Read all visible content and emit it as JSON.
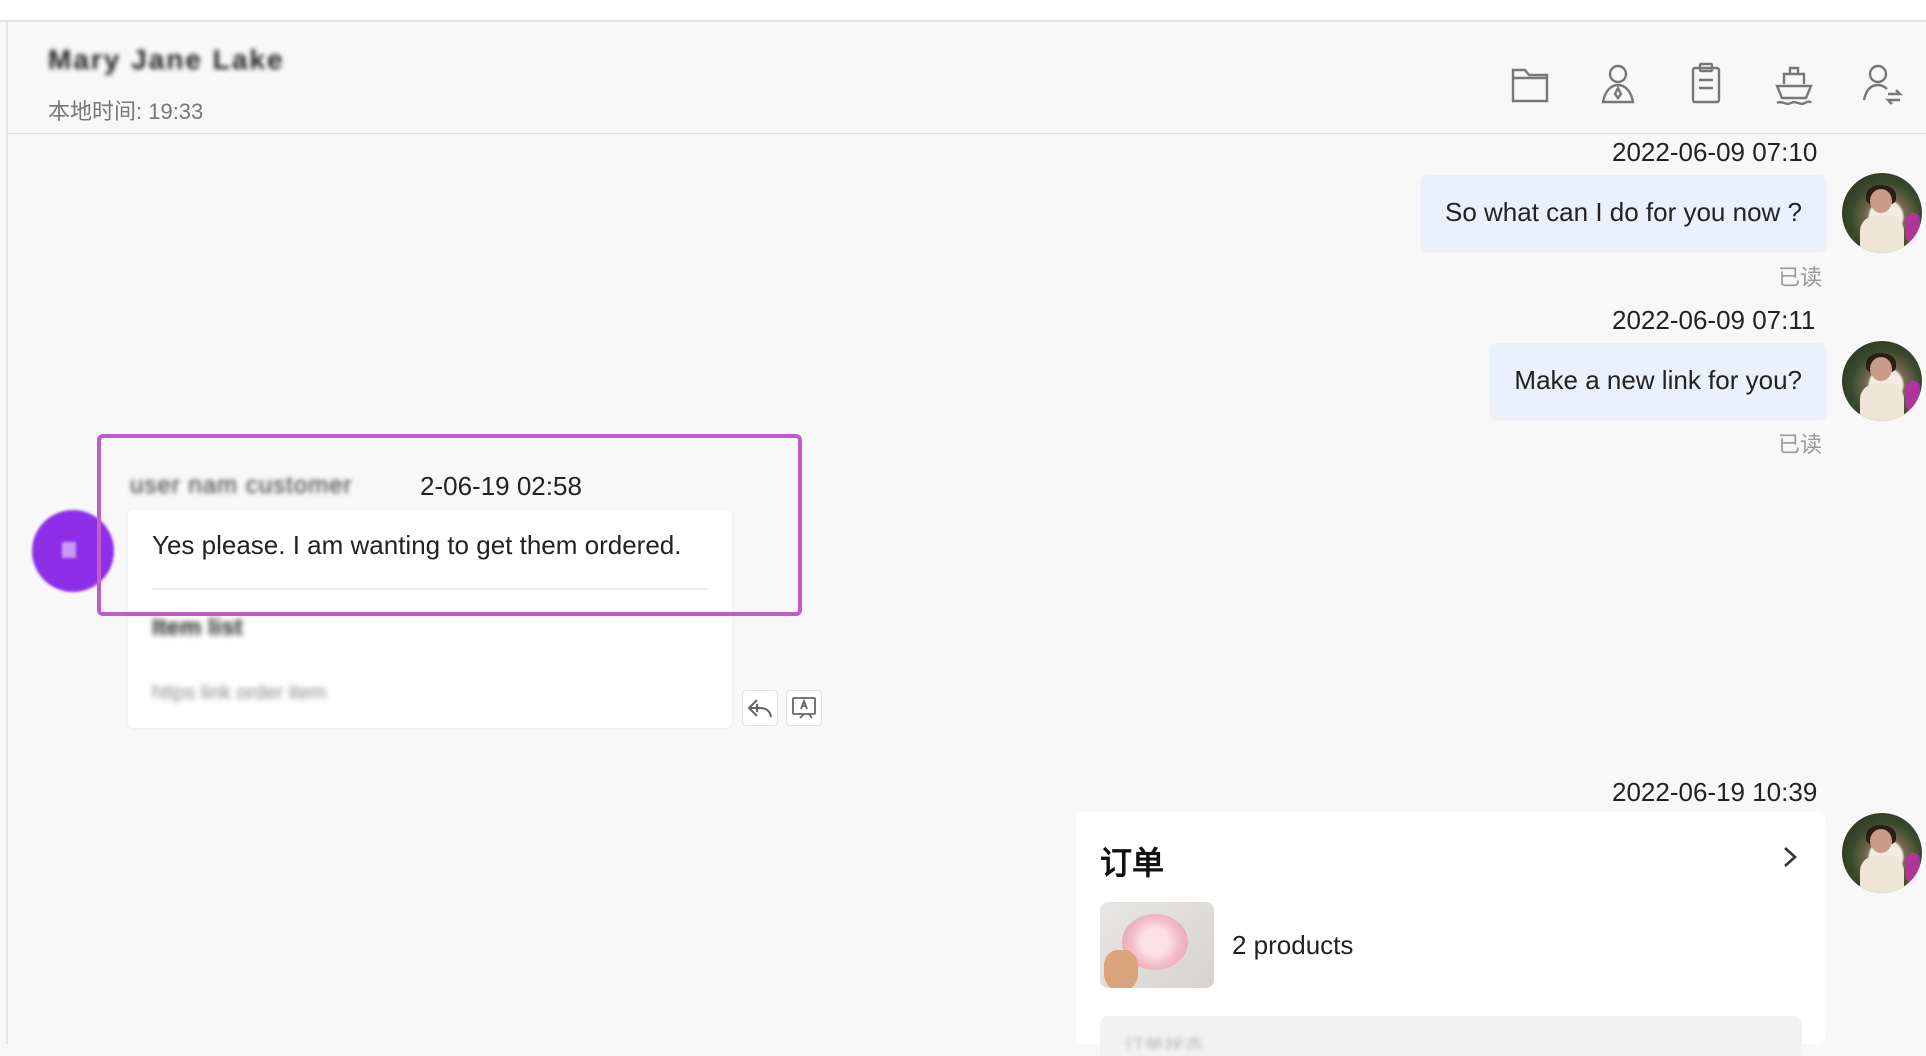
{
  "header": {
    "contact_name": "Mary Jane Lake",
    "local_time": "本地时间: 19:33",
    "toolbar": [
      {
        "icon": "folder-icon"
      },
      {
        "icon": "user-icon"
      },
      {
        "icon": "clipboard-icon"
      },
      {
        "icon": "ship-icon"
      },
      {
        "icon": "user-transfer-icon"
      }
    ]
  },
  "messages": [
    {
      "direction": "out",
      "timestamp": "2022-06-09 07:10",
      "text": "So what can I do for you now ?",
      "status": "已读"
    },
    {
      "direction": "out",
      "timestamp": "2022-06-09 07:11",
      "text": "Make a new link for you?",
      "status": "已读"
    },
    {
      "direction": "in",
      "sender": "user nam customer",
      "timestamp": "2-06-19 02:58",
      "text": "Yes please. I am wanting to get them ordered.",
      "blur_line1": "Item list",
      "blur_line2": "https link order item",
      "actions": [
        "reply-icon",
        "translate-icon"
      ]
    },
    {
      "direction": "out",
      "timestamp": "2022-06-19 10:39",
      "card": {
        "title": "订单",
        "products": "2 products",
        "footer": "订单状态"
      }
    }
  ],
  "colors": {
    "outgoing_bubble": "#e8f1fc",
    "highlight": "#bf5cc8",
    "incoming_avatar": "#8d2ee8"
  }
}
